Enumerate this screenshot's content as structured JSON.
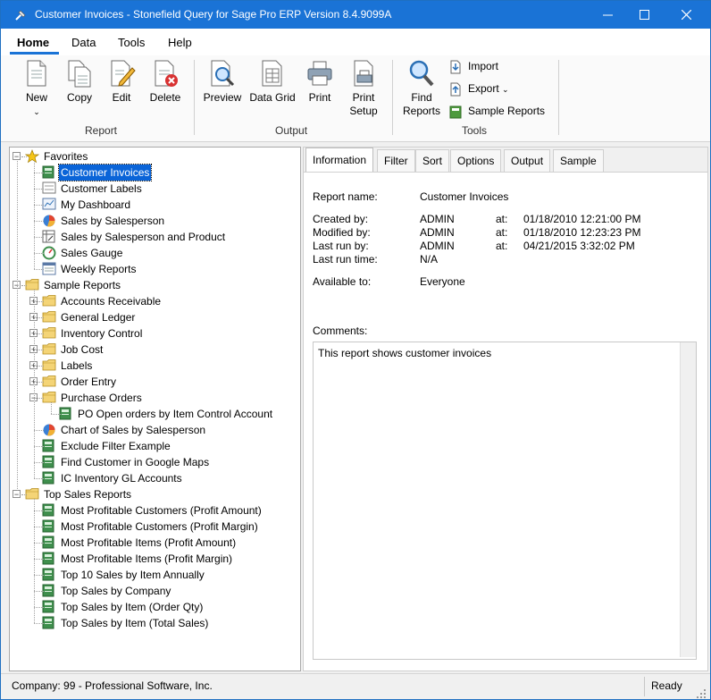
{
  "window": {
    "title": "Customer Invoices - Stonefield Query for Sage Pro ERP Version 8.4.9099A"
  },
  "menu": {
    "tabs": [
      "Home",
      "Data",
      "Tools",
      "Help"
    ]
  },
  "ribbon": {
    "report_group": {
      "label": "Report",
      "new": "New",
      "copy": "Copy",
      "edit": "Edit",
      "delete": "Delete"
    },
    "output_group": {
      "label": "Output",
      "preview": "Preview",
      "data_grid": "Data Grid",
      "print": "Print",
      "print_setup_1": "Print",
      "print_setup_2": "Setup"
    },
    "tools_group": {
      "label": "Tools",
      "find_1": "Find",
      "find_2": "Reports",
      "import": "Import",
      "export": "Export",
      "sample_reports": "Sample Reports"
    }
  },
  "tree": {
    "favorites": {
      "label": "Favorites",
      "items": [
        "Customer Invoices",
        "Customer Labels",
        "My Dashboard",
        "Sales by Salesperson",
        "Sales by Salesperson and Product",
        "Sales Gauge",
        "Weekly Reports"
      ]
    },
    "sample_reports": {
      "label": "Sample Reports",
      "folders": [
        "Accounts Receivable",
        "General Ledger",
        "Inventory Control",
        "Job Cost",
        "Labels",
        "Order Entry",
        "Purchase Orders"
      ],
      "po_child": "PO Open orders by Item Control Account",
      "items": [
        "Chart of Sales by Salesperson",
        "Exclude Filter Example",
        "Find Customer in Google Maps",
        "IC Inventory GL Accounts"
      ]
    },
    "top_sales": {
      "label": "Top Sales Reports",
      "items": [
        "Most Profitable Customers (Profit Amount)",
        "Most Profitable Customers (Profit Margin)",
        "Most Profitable Items (Profit Amount)",
        "Most Profitable Items (Profit Margin)",
        "Top 10 Sales by Item Annually",
        "Top Sales by Company",
        "Top Sales by Item (Order Qty)",
        "Top Sales by Item (Total Sales)"
      ]
    }
  },
  "tabs": [
    "Information",
    "Filter",
    "Sort",
    "Options",
    "Output",
    "Sample"
  ],
  "info": {
    "report_name_label": "Report name:",
    "report_name": "Customer Invoices",
    "created_label": "Created by:",
    "created_by": "ADMIN",
    "created_at": "01/18/2010 12:21:00 PM",
    "modified_label": "Modified by:",
    "modified_by": "ADMIN",
    "modified_at": "01/18/2010 12:23:23 PM",
    "lastrun_label": "Last run by:",
    "lastrun_by": "ADMIN",
    "lastrun_at": "04/21/2015 3:32:02 PM",
    "lastrun_time_label": "Last run time:",
    "lastrun_time": "N/A",
    "available_label": "Available to:",
    "available": "Everyone",
    "at_label": "at:",
    "comments_label": "Comments:",
    "comments": "This report shows customer invoices"
  },
  "status": {
    "company": "Company: 99 - Professional Software, Inc.",
    "state": "Ready"
  },
  "colors": {
    "titlebar": "#1a73d6",
    "selection": "#0a64d8"
  }
}
